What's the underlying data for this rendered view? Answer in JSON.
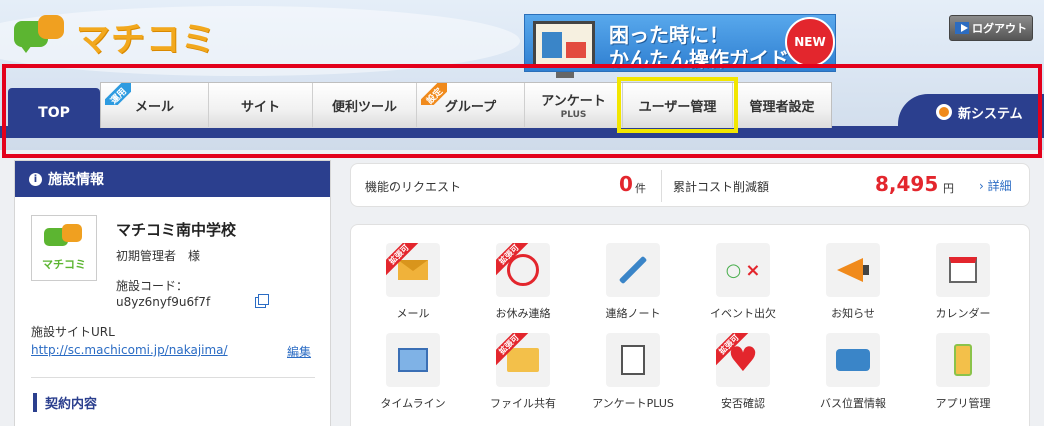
{
  "header": {
    "logo_text": "マチコミ",
    "banner": {
      "line1": "困った時に！",
      "line2": "かんたん操作ガイド",
      "badge": "NEW"
    },
    "logout_label": "ログアウト"
  },
  "nav": {
    "top_label": "TOP",
    "tabs": [
      {
        "label": "メール",
        "ribbon": "運用"
      },
      {
        "label": "サイト"
      },
      {
        "label": "便利ツール"
      },
      {
        "label": "グループ",
        "ribbon": "設定"
      },
      {
        "label": "アンケート",
        "sub": "PLUS"
      },
      {
        "label": "ユーザー管理"
      },
      {
        "label": "管理者設定"
      }
    ],
    "new_system_label": "新システム"
  },
  "facility": {
    "header": "施設情報",
    "name": "マチコミ南中学校",
    "admin": "初期管理者　様",
    "code_label": "施設コード：",
    "code": "u8yz6nyf9u6f7f",
    "site_label": "施設サイトURL",
    "site_url": "http://sc.machicomi.jp/nakajima/",
    "edit_label": "編集",
    "contract_label": "契約内容",
    "logo_text": "マチコミ"
  },
  "stats": {
    "request_label": "機能のリクエスト",
    "request_value": "0",
    "request_unit": "件",
    "cost_label": "累計コスト削減額",
    "cost_value": "8,495",
    "cost_unit": "円",
    "detail_label": "› 詳細"
  },
  "features": [
    {
      "label": "メール",
      "badge": "拡張可",
      "icon": "mail-icon"
    },
    {
      "label": "お休み連絡",
      "badge": "拡張可",
      "icon": "absence-stamp-icon"
    },
    {
      "label": "連絡ノート",
      "icon": "pen-icon"
    },
    {
      "label": "イベント出欠",
      "icon": "attendance-icon"
    },
    {
      "label": "お知らせ",
      "icon": "megaphone-icon"
    },
    {
      "label": "カレンダー",
      "icon": "calendar-icon"
    },
    {
      "label": "タイムライン",
      "icon": "photo-icon"
    },
    {
      "label": "ファイル共有",
      "badge": "拡張可",
      "icon": "folder-icon"
    },
    {
      "label": "アンケートPLUS",
      "icon": "clipboard-icon"
    },
    {
      "label": "安否確認",
      "badge": "拡張可",
      "icon": "heart-icon"
    },
    {
      "label": "バス位置情報",
      "icon": "bus-icon"
    },
    {
      "label": "アプリ管理",
      "icon": "app-phone-icon"
    }
  ],
  "colors": {
    "navy": "#2b3f8e",
    "red": "#e3262d",
    "highlight_red": "#e3001b",
    "highlight_yellow": "#f2e600"
  }
}
